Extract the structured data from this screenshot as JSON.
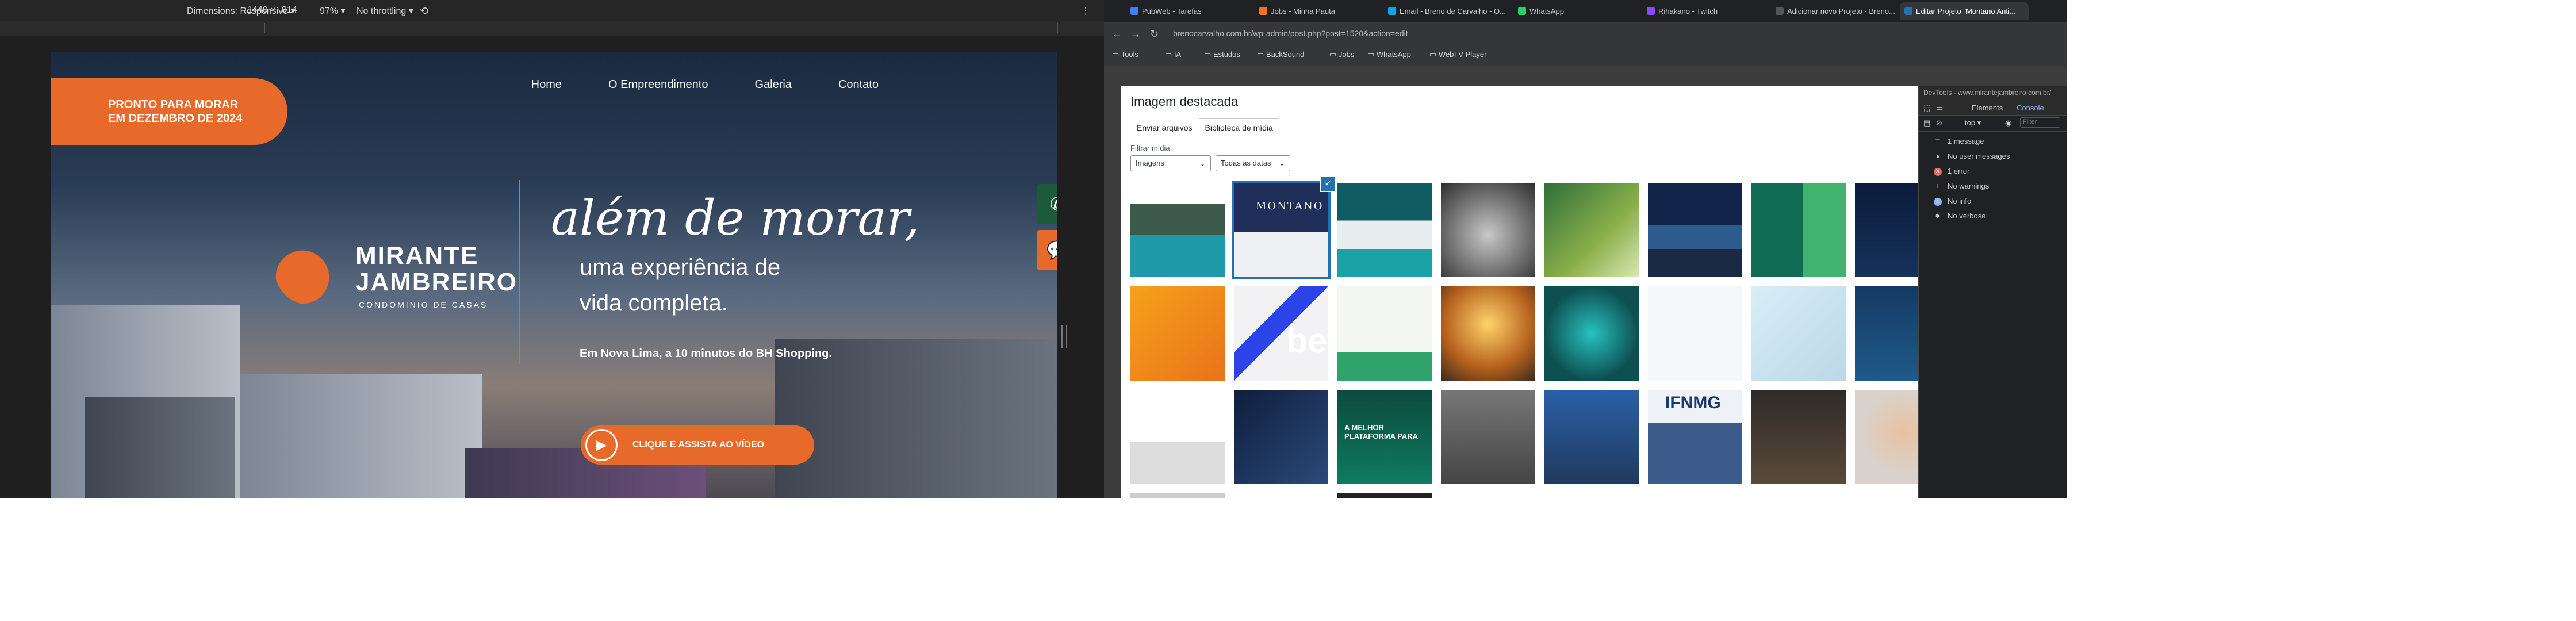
{
  "devtoolsbar": {
    "dimensions_label": "Dimensions: Responsive",
    "width": "1440",
    "times": "×",
    "height": "814",
    "zoom": "97%",
    "throttling": "No throttling"
  },
  "site": {
    "badge_line1": "PRONTO PARA MORAR",
    "badge_line2": "EM DEZEMBRO DE 2024",
    "nav": [
      "Home",
      "O Empreendimento",
      "Galeria",
      "Contato"
    ],
    "logo_line1": "MIRANTE",
    "logo_line2": "JAMBREIRO",
    "logo_sub": "CONDOMÍNIO DE CASAS",
    "headline_script": "além de morar,",
    "headline_line1": "uma experiência de",
    "headline_line2": "vida completa.",
    "subtext": "Em Nova Lima, a 10 minutos do BH Shopping.",
    "cta_label": "CLIQUE E ASSISTA AO VÍDEO"
  },
  "browser": {
    "tabs": [
      {
        "label": "PubWeb - Tarefas",
        "color": "#3b82f6"
      },
      {
        "label": "Jobs - Minha Pauta",
        "color": "#f97316"
      },
      {
        "label": "Email - Breno de Carvalho - O...",
        "color": "#0ea5e9"
      },
      {
        "label": "WhatsApp",
        "color": "#25d366"
      },
      {
        "label": "Rihakano - Twitch",
        "color": "#9146ff"
      },
      {
        "label": "Adicionar novo Projeto - Breno...",
        "color": "#555555"
      },
      {
        "label": "Editar Projeto \"Montano Anti...",
        "color": "#2271b1"
      }
    ],
    "url": "brenocarvalho.com.br/wp-admin/post.php?post=1520&action=edit",
    "bookmarks": [
      "Tools",
      "IA",
      "Estudos",
      "BackSound",
      "Jobs",
      "WhatsApp",
      "WebTV Player"
    ]
  },
  "modal": {
    "title": "Imagem destacada",
    "tab_upload": "Enviar arquivos",
    "tab_library": "Biblioteca de mídia",
    "filter_label": "Filtrar mídia",
    "filter_type": "Imagens",
    "filter_date": "Todas as datas",
    "thumb_texts": [
      "MONTANO",
      "be",
      "IFNMG",
      "A MELHOR PLATAFORMA PARA"
    ]
  },
  "devtools": {
    "header": "DevTools - www.mirantejambreiro.com.br/",
    "tab_elements": "Elements",
    "tab_console": "Console",
    "context": "top",
    "filter_placeholder": "Filter",
    "messages": [
      {
        "label": "1 message",
        "icon": "list-icon"
      },
      {
        "label": "No user messages",
        "icon": "user-icon"
      },
      {
        "label": "1 error",
        "icon": "error-icon"
      },
      {
        "label": "No warnings",
        "icon": "warning-icon"
      },
      {
        "label": "No info",
        "icon": "info-icon"
      },
      {
        "label": "No verbose",
        "icon": "bug-icon"
      }
    ]
  }
}
